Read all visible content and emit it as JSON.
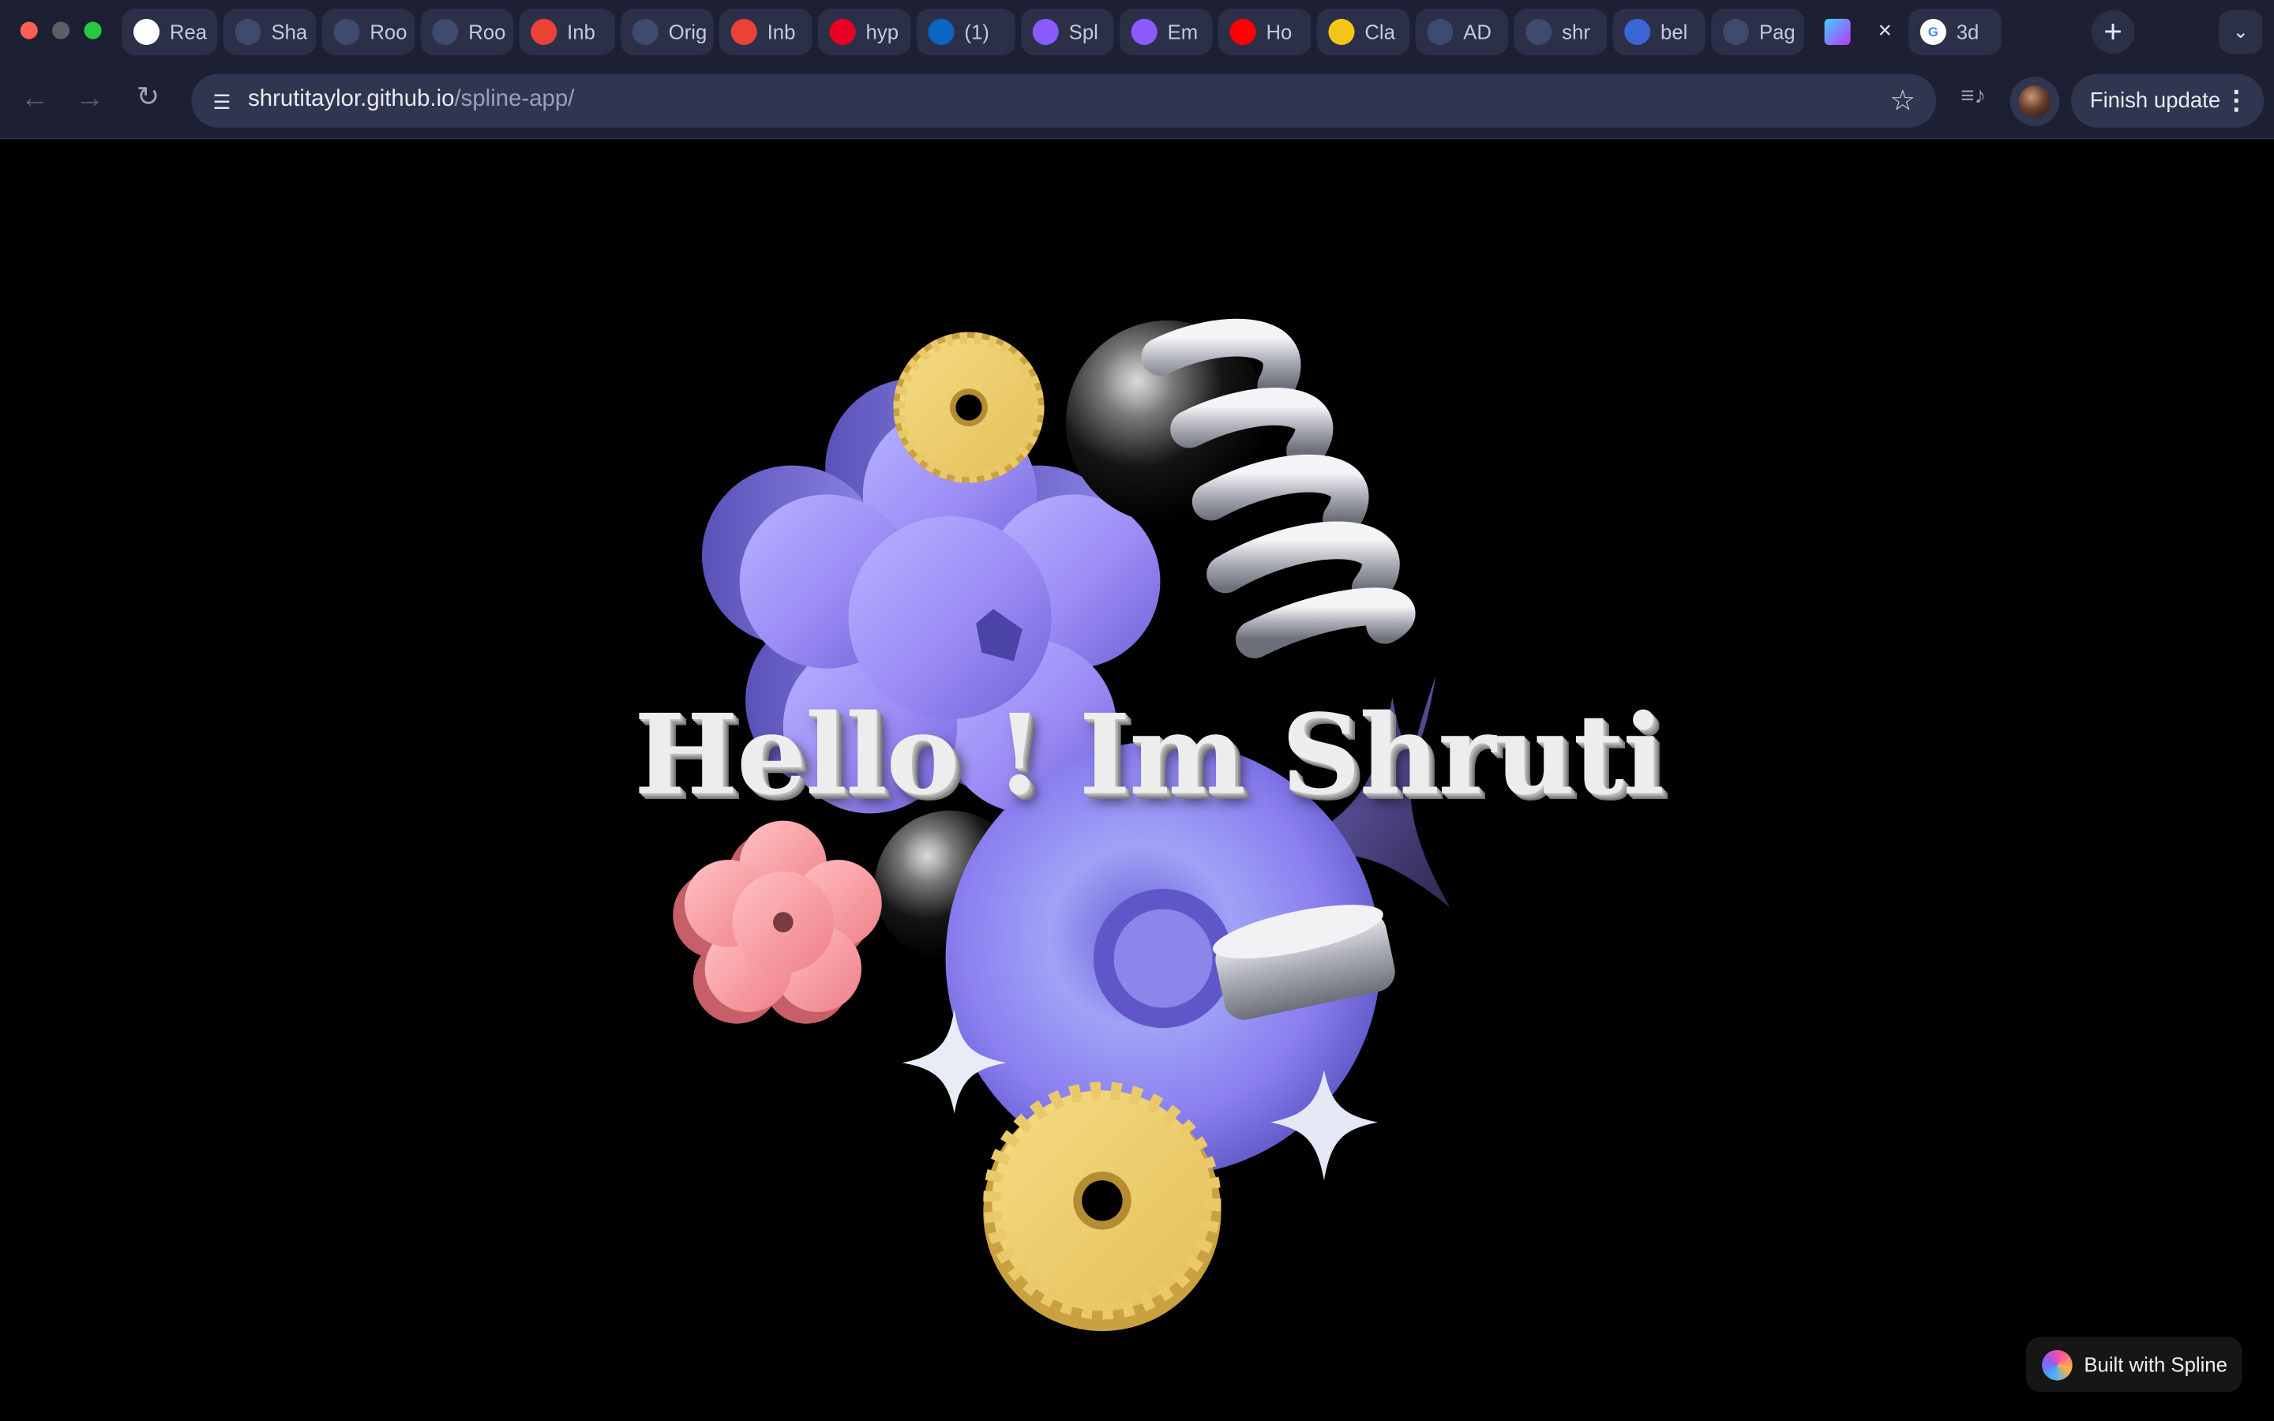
{
  "browser": {
    "tabs": [
      {
        "label": "Rea",
        "icon": "openai-icon",
        "color": "#ffffff"
      },
      {
        "label": "Sha",
        "icon": "frontend-mentor-icon",
        "color": "#3e4a6e"
      },
      {
        "label": "Roo",
        "icon": "frontend-mentor-icon",
        "color": "#3e4a6e"
      },
      {
        "label": "Roo",
        "icon": "frontend-mentor-icon",
        "color": "#3e4a6e"
      },
      {
        "label": "Inb",
        "icon": "gmail-icon",
        "color": "#ea4335"
      },
      {
        "label": "Orig",
        "icon": "origin-icon",
        "color": "#3e4a6e"
      },
      {
        "label": "Inb",
        "icon": "gmail-icon",
        "color": "#ea4335"
      },
      {
        "label": "hyp",
        "icon": "pinterest-icon",
        "color": "#e60023"
      },
      {
        "label": "(1)",
        "icon": "linkedin-icon",
        "color": "#0a66c2"
      },
      {
        "label": "Spl",
        "icon": "spline-icon",
        "color": "#8a5bff"
      },
      {
        "label": "Em",
        "icon": "spline-icon",
        "color": "#8a5bff"
      },
      {
        "label": "Ho",
        "icon": "youtube-icon",
        "color": "#ff0000"
      },
      {
        "label": "Cla",
        "icon": "claude-icon",
        "color": "#f5c518"
      },
      {
        "label": "AD",
        "icon": "origin-icon",
        "color": "#3e4a6e"
      },
      {
        "label": "shr",
        "icon": "github-icon",
        "color": "#3e4a6e"
      },
      {
        "label": "bel",
        "icon": "bing-icon",
        "color": "#3a66d8"
      },
      {
        "label": "Pag",
        "icon": "github-icon",
        "color": "#3e4a6e"
      }
    ],
    "active_tab": {
      "icon": "vite-icon",
      "close": "×"
    },
    "last_tab": {
      "label": "3d",
      "icon": "google-icon"
    },
    "new_tab": "+",
    "tab_search": "⌄",
    "url_host": "shrutitaylor.github.io",
    "url_path": "/spline-app/",
    "finish_update": "Finish update",
    "menu": "⋮"
  },
  "page": {
    "headline": "Hello ! Im Shruti",
    "badge": "Built with Spline"
  },
  "colors": {
    "accent_purple": "#9b8cf5",
    "gear_yellow": "#e8c766",
    "flower_pink": "#f48a93",
    "background": "#000000"
  }
}
